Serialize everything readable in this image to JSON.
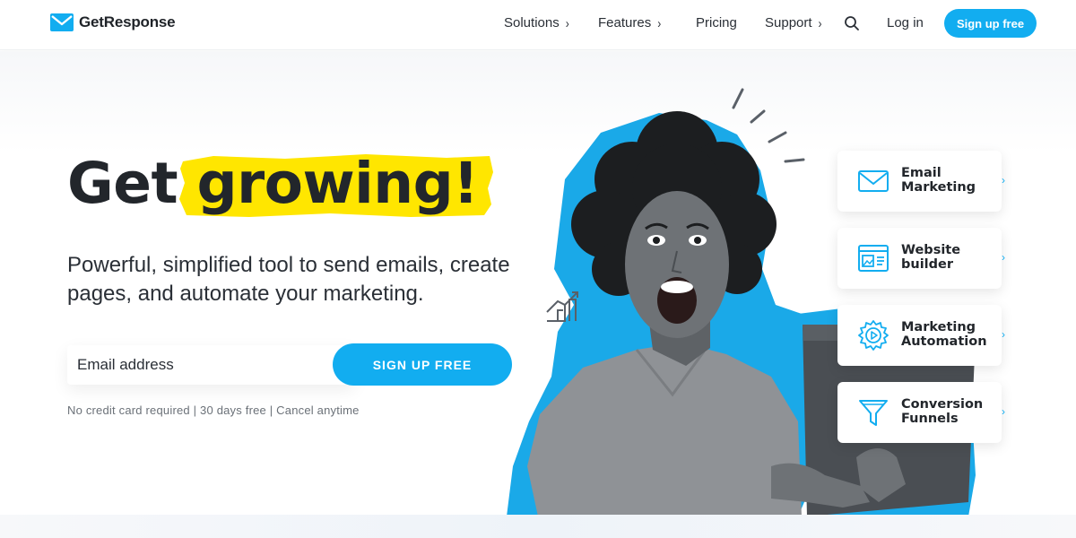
{
  "brand": {
    "name": "GetResponse",
    "accent": "#12adf0",
    "highlight": "#ffe600"
  },
  "nav": {
    "items": [
      {
        "label": "Solutions",
        "has_chevron": true
      },
      {
        "label": "Features",
        "has_chevron": true
      },
      {
        "label": "Pricing",
        "has_chevron": false
      },
      {
        "label": "Support",
        "has_chevron": true
      }
    ],
    "search_icon": "search-icon",
    "login_label": "Log in",
    "signup_label": "Sign up free"
  },
  "hero": {
    "headline_part1": "Get",
    "headline_part2": "growing!",
    "subhead": "Powerful, simplified tool to send emails, create pages, and automate your marketing.",
    "email_placeholder": "Email address",
    "cta_label": "SIGN UP FREE",
    "disclaimer": "No credit card required | 30 days free | Cancel anytime"
  },
  "features": [
    {
      "label_line1": "Email",
      "label_line2": "Marketing",
      "icon": "envelope-icon"
    },
    {
      "label_line1": "Website",
      "label_line2": "builder",
      "icon": "website-builder-icon"
    },
    {
      "label_line1": "Marketing",
      "label_line2": "Automation",
      "icon": "gear-play-icon"
    },
    {
      "label_line1": "Conversion",
      "label_line2": "Funnels",
      "icon": "funnel-icon"
    }
  ]
}
